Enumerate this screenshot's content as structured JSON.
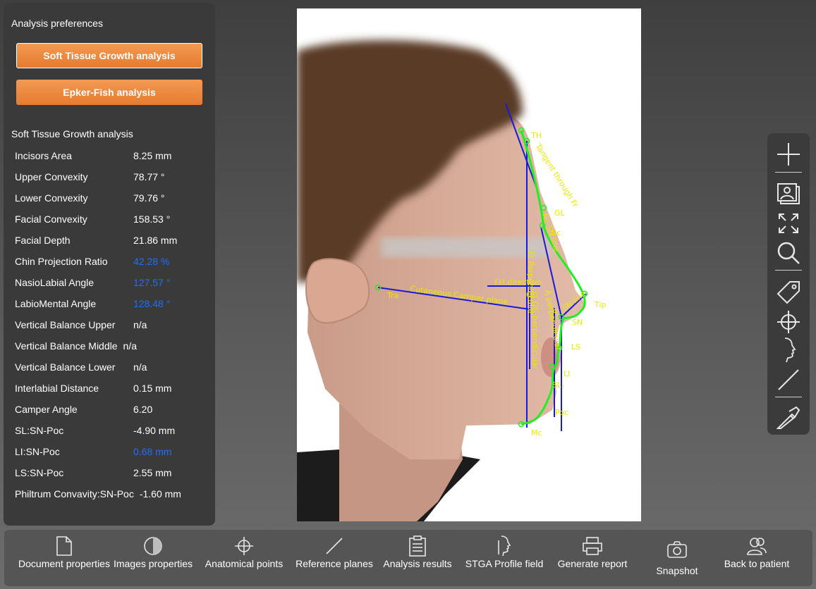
{
  "left_panel": {
    "preferences_heading": "Analysis preferences",
    "buttons": [
      {
        "label": "Soft Tissue Growth analysis",
        "selected": true
      },
      {
        "label": "Epker-Fish analysis",
        "selected": false
      }
    ],
    "results_heading": "Soft Tissue Growth analysis",
    "metrics": [
      {
        "label": "Incisors Area",
        "value": "8.25 mm",
        "highlight": false
      },
      {
        "label": "Upper Convexity",
        "value": "78.77 °",
        "highlight": false
      },
      {
        "label": "Lower Convexity",
        "value": "79.76 °",
        "highlight": false
      },
      {
        "label": "Facial Convexity",
        "value": "158.53 °",
        "highlight": false
      },
      {
        "label": "Facial Depth",
        "value": "21.86 mm",
        "highlight": false
      },
      {
        "label": "Chin Projection Ratio",
        "value": "42.28 %",
        "highlight": true
      },
      {
        "label": "NasioLabial Angle",
        "value": "127.57 °",
        "highlight": true
      },
      {
        "label": "LabioMental Angle",
        "value": "128.48 °",
        "highlight": true
      },
      {
        "label": "Vertical Balance Upper",
        "value": "n/a",
        "highlight": false
      },
      {
        "label": "Vertical Balance Middle",
        "value": "n/a",
        "highlight": false
      },
      {
        "label": "Vertical Balance Lower",
        "value": "n/a",
        "highlight": false
      },
      {
        "label": "Interlabial Distance",
        "value": "0.15 mm",
        "highlight": false
      },
      {
        "label": "Camper Angle",
        "value": "6.20",
        "highlight": false
      },
      {
        "label": "SL:SN-Poc",
        "value": "-4.90 mm",
        "highlight": false
      },
      {
        "label": "LI:SN-Poc",
        "value": "0.68 mm",
        "highlight": true
      },
      {
        "label": "LS:SN-Poc",
        "value": "2.55 mm",
        "highlight": false
      },
      {
        "label": "Philtrum Convavity:SN-Poc",
        "value": "-1.60 mm",
        "highlight": false
      }
    ]
  },
  "viewer": {
    "landmarks": {
      "th": "TH",
      "gl": "GL",
      "nc": "Nc",
      "tip": "Tip",
      "sn": "SN",
      "ls": "LS",
      "li": "LI",
      "sl": "SL",
      "poc": "Poc",
      "mc": "Mc",
      "tra": "Tra",
      "og": "OG",
      "a": "A"
    },
    "plane_labels": {
      "camper": "Cutaneous Camper plane",
      "fh": "FH direction",
      "fr_perp": "Fr Perpendicular",
      "tangent_fr": "Tangent through Fr",
      "og_perp": "OG perpendicular",
      "a_perp": "A perpendicular",
      "sn_line": "SN line",
      "nc_sn": "Nc-SN line"
    }
  },
  "right_toolbar": {
    "tools": [
      "add-icon",
      "images-icon",
      "fit-screen-icon",
      "zoom-icon",
      "tag-icon",
      "crosshair-icon",
      "profile-icon",
      "line-icon",
      "caliper-icon"
    ]
  },
  "bottom_bar": {
    "buttons": [
      {
        "label": "Document properties",
        "icon": "document-icon"
      },
      {
        "label": "Images properties",
        "icon": "images-properties-icon"
      },
      {
        "label": "Anatomical points",
        "icon": "crosshair-icon"
      },
      {
        "label": "Reference planes",
        "icon": "line-icon"
      },
      {
        "label": "Analysis results",
        "icon": "clipboard-icon"
      },
      {
        "label": "STGA Profile field",
        "icon": "profile-icon"
      },
      {
        "label": "Generate report",
        "icon": "printer-icon"
      },
      {
        "label": "Snapshot",
        "icon": "camera-icon"
      },
      {
        "label": "Back to patient",
        "icon": "patient-icon"
      }
    ]
  },
  "colors": {
    "accent_orange": "#ee8a3d",
    "highlight_blue": "#1f6fff",
    "landmark_yellow": "#e8e800",
    "profile_green": "#22ee22",
    "plane_blue": "#1a1ad6"
  }
}
